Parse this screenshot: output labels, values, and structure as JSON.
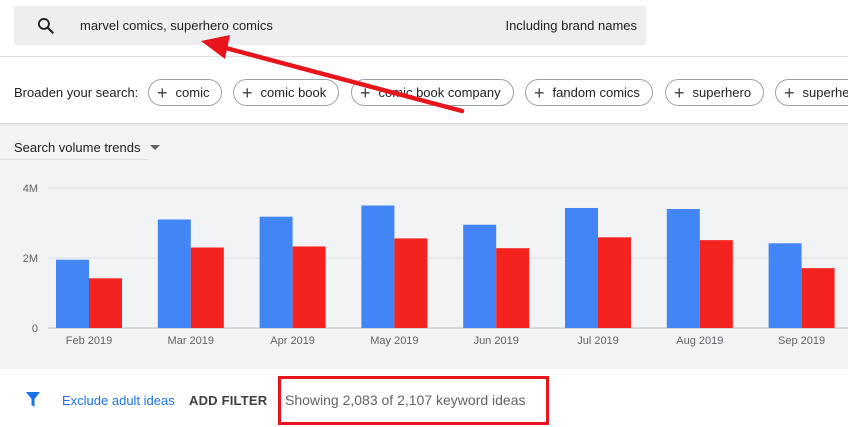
{
  "search": {
    "query": "marvel comics, superhero comics",
    "brand_toggle_label": "Including brand names"
  },
  "broaden": {
    "label": "Broaden your search:",
    "chips": [
      "comic",
      "comic book",
      "comic book company",
      "fandom comics",
      "superhero",
      "superhe"
    ]
  },
  "chart_section": {
    "selector_label": "Search volume trends"
  },
  "chart_data": {
    "type": "bar",
    "categories": [
      "Feb 2019",
      "Mar 2019",
      "Apr 2019",
      "May 2019",
      "Jun 2019",
      "Jul 2019",
      "Aug 2019",
      "Sep 2019"
    ],
    "series": [
      {
        "values": [
          1950000,
          3100000,
          3180000,
          3500000,
          2950000,
          3430000,
          3400000,
          2420000
        ]
      },
      {
        "values": [
          1420000,
          2300000,
          2330000,
          2560000,
          2280000,
          2590000,
          2510000,
          1710000
        ]
      }
    ],
    "y_ticks": [
      0,
      2000000,
      4000000
    ],
    "y_tick_labels": [
      "0",
      "2M",
      "4M"
    ],
    "ylim": [
      0,
      4000000
    ],
    "grid": true,
    "colors": [
      "#4285f4",
      "#f4231f"
    ]
  },
  "filters": {
    "exclude_label": "Exclude adult ideas",
    "add_filter_label": "ADD FILTER",
    "showing_text": "Showing 2,083 of 2,107 keyword ideas"
  },
  "colors": {
    "accent_blue": "#1a73e8",
    "annotation_red": "#e8141c",
    "panel_bg": "#f1f3f4"
  }
}
